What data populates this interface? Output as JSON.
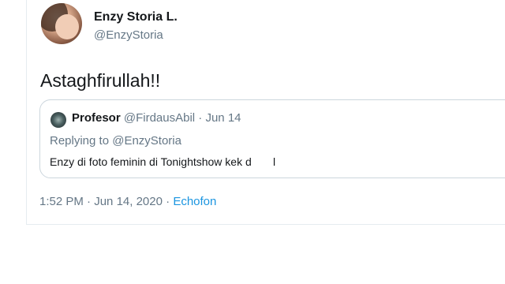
{
  "author": {
    "display_name": "Enzy Storia L.",
    "handle": "@EnzyStoria"
  },
  "tweet": {
    "text": "Astaghfirullah!!"
  },
  "quoted_tweet": {
    "author_name": "Profesor",
    "author_handle": "@FirdausAbil",
    "separator": "·",
    "date": "Jun 14",
    "replying_prefix": "Replying to",
    "replying_to": "@EnzyStoria",
    "text": "Enzy di foto feminin di Tonightshow kek d       l"
  },
  "meta": {
    "time": "1:52 PM",
    "separator1": "·",
    "date": "Jun 14, 2020",
    "separator2": "·",
    "source": "Echofon"
  },
  "colors": {
    "text_primary": "#14171a",
    "text_secondary": "#657786",
    "link": "#1b95e0",
    "border": "#ccd6dd"
  }
}
